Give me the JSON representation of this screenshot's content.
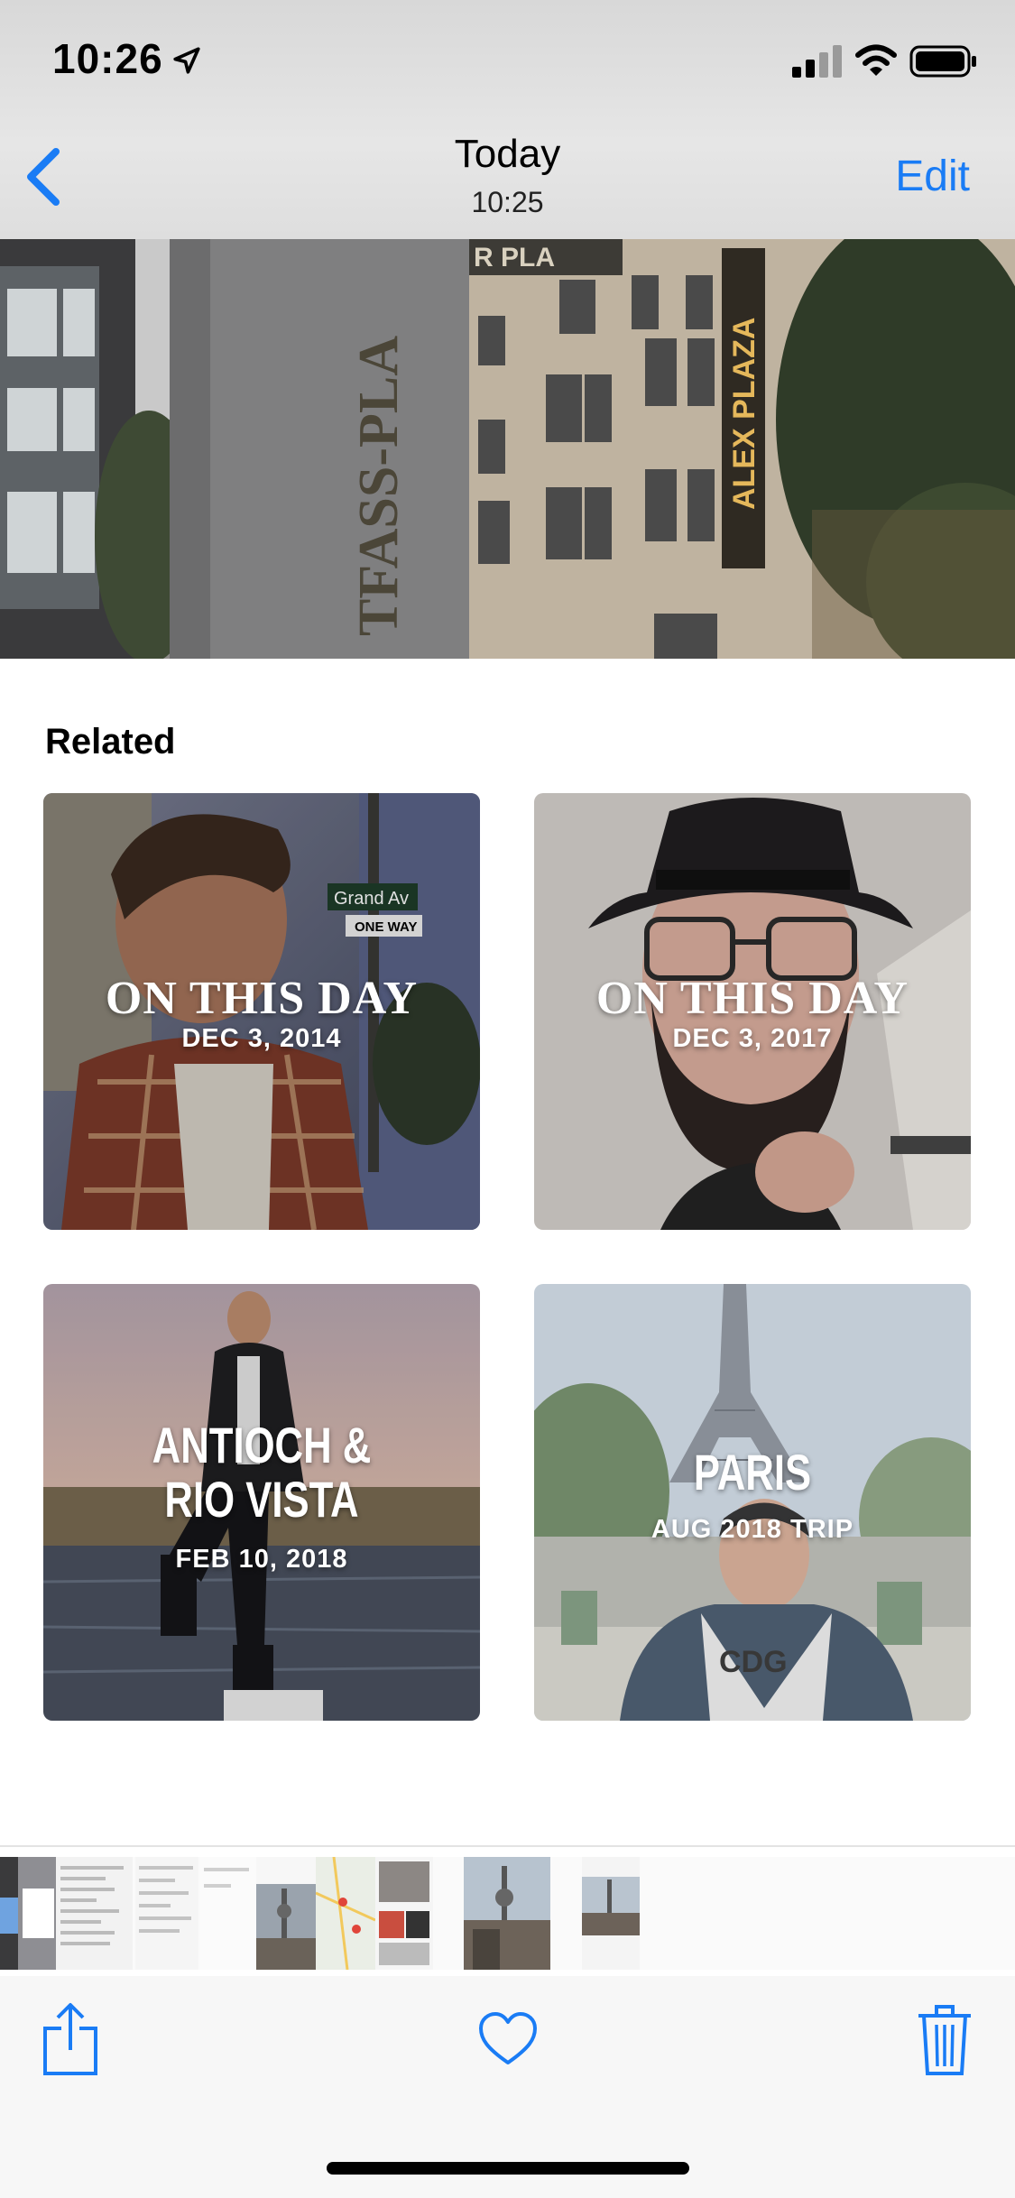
{
  "status_bar": {
    "time": "10:26"
  },
  "nav": {
    "title": "Today",
    "subtitle": "10:25",
    "edit_label": "Edit",
    "accent": "#1a7cf5"
  },
  "related": {
    "heading": "Related",
    "cards": [
      {
        "title": "ON THIS DAY",
        "subtitle": "DEC 3, 2014"
      },
      {
        "title": "ON THIS DAY",
        "subtitle": "DEC 3, 2017"
      },
      {
        "title_line1": "ANTIOCH &",
        "title_line2": "RIO VISTA",
        "subtitle": "FEB 10, 2018"
      },
      {
        "title": "PARIS",
        "subtitle": "AUG 2018 TRIP"
      }
    ]
  },
  "toolbar": {
    "icons": [
      "share-icon",
      "heart-icon",
      "trash-icon"
    ]
  }
}
